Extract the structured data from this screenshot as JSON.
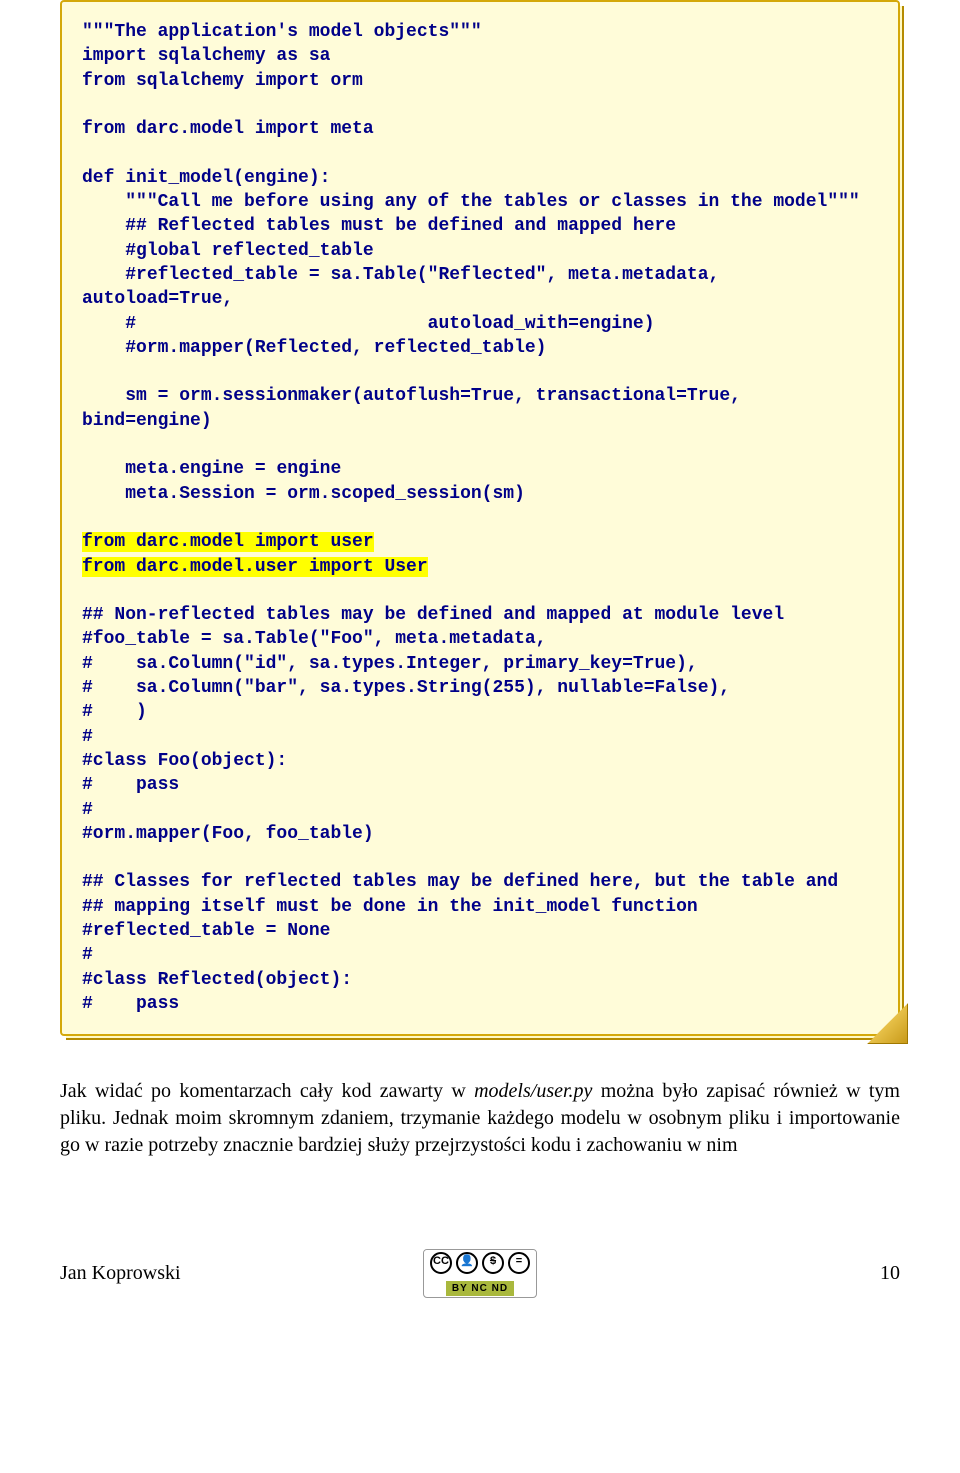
{
  "code": {
    "line01": "\"\"\"The application's model objects\"\"\"",
    "line02": "import sqlalchemy as sa",
    "line03": "from sqlalchemy import orm",
    "line04": "",
    "line05": "from darc.model import meta",
    "line06": "",
    "line07": "def init_model(engine):",
    "line08": "    \"\"\"Call me before using any of the tables or classes in the model\"\"\"",
    "line09": "    ## Reflected tables must be defined and mapped here",
    "line10": "    #global reflected_table",
    "line11": "    #reflected_table = sa.Table(\"Reflected\", meta.metadata, autoload=True,",
    "line12": "    #                           autoload_with=engine)",
    "line13": "    #orm.mapper(Reflected, reflected_table)",
    "line14": "",
    "line15": "    sm = orm.sessionmaker(autoflush=True, transactional=True, bind=engine)",
    "line16": "",
    "line17": "    meta.engine = engine",
    "line18": "    meta.Session = orm.scoped_session(sm)",
    "line19": "",
    "hl1": "from darc.model import user",
    "hl2": "from darc.model.user import User",
    "line20": "",
    "line21": "## Non-reflected tables may be defined and mapped at module level",
    "line22": "#foo_table = sa.Table(\"Foo\", meta.metadata,",
    "line23": "#    sa.Column(\"id\", sa.types.Integer, primary_key=True),",
    "line24": "#    sa.Column(\"bar\", sa.types.String(255), nullable=False),",
    "line25": "#    )",
    "line26": "#",
    "line27": "#class Foo(object):",
    "line28": "#    pass",
    "line29": "#",
    "line30": "#orm.mapper(Foo, foo_table)",
    "line31": "",
    "line32": "## Classes for reflected tables may be defined here, but the table and",
    "line33": "## mapping itself must be done in the init_model function",
    "line34": "#reflected_table = None",
    "line35": "#",
    "line36": "#class Reflected(object):",
    "line37": "#    pass"
  },
  "body": {
    "prefix": "Jak widać po komentarzach cały kod zawarty w ",
    "italic": "models/user.py",
    "suffix": " można było zapisać również w tym pliku. Jednak moim skromnym zdaniem, trzymanie każdego modelu w osobnym pliku i importowanie go w razie potrzeby znacznie bardziej służy przejrzystości kodu i zachowaniu w nim"
  },
  "footer": {
    "author": "Jan Koprowski",
    "page": "10",
    "cc_icons": {
      "cc": "CC",
      "by": "👤",
      "nc": "$",
      "nd": "="
    },
    "cc_label": "BY  NC  ND"
  }
}
